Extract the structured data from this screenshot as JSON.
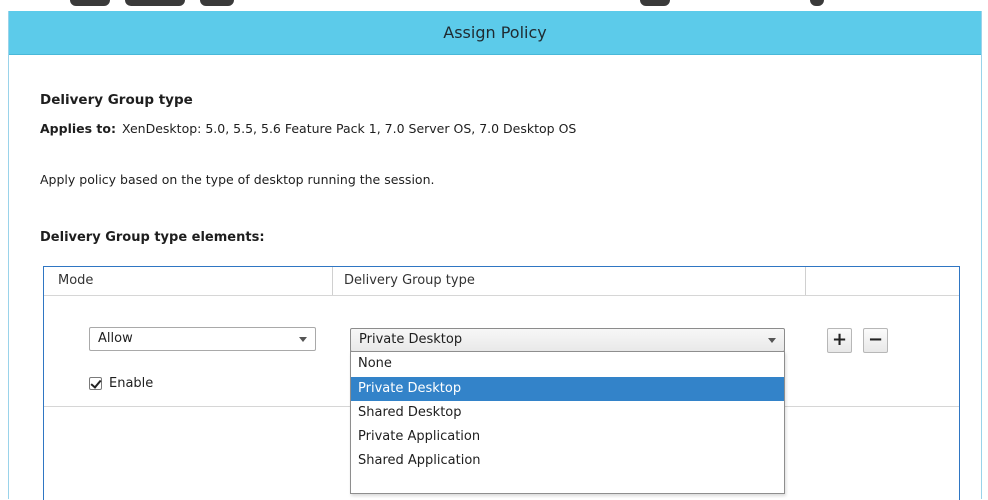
{
  "dialog": {
    "title": "Assign Policy"
  },
  "setting": {
    "name": "Delivery Group type",
    "applies_to_label": "Applies to:",
    "applies_to_value": "XenDesktop: 5.0, 5.5, 5.6 Feature Pack 1, 7.0 Server OS, 7.0 Desktop OS",
    "description": "Apply policy based on the type of desktop running the session.",
    "elements_heading": "Delivery Group type elements:"
  },
  "grid": {
    "columns": [
      "Mode",
      "Delivery Group type"
    ],
    "row": {
      "mode_value": "Allow",
      "type_value": "Private Desktop",
      "enable_label": "Enable",
      "enable_checked": true,
      "add_label": "+",
      "remove_label": "−"
    }
  },
  "dropdown": {
    "options": [
      "None",
      "Private Desktop",
      "Shared Desktop",
      "Private Application",
      "Shared Application"
    ],
    "selected_index": 1
  },
  "colors": {
    "titlebar": "#5ccbea",
    "selection": "#3383c9",
    "grid_border": "#2f76c3"
  }
}
